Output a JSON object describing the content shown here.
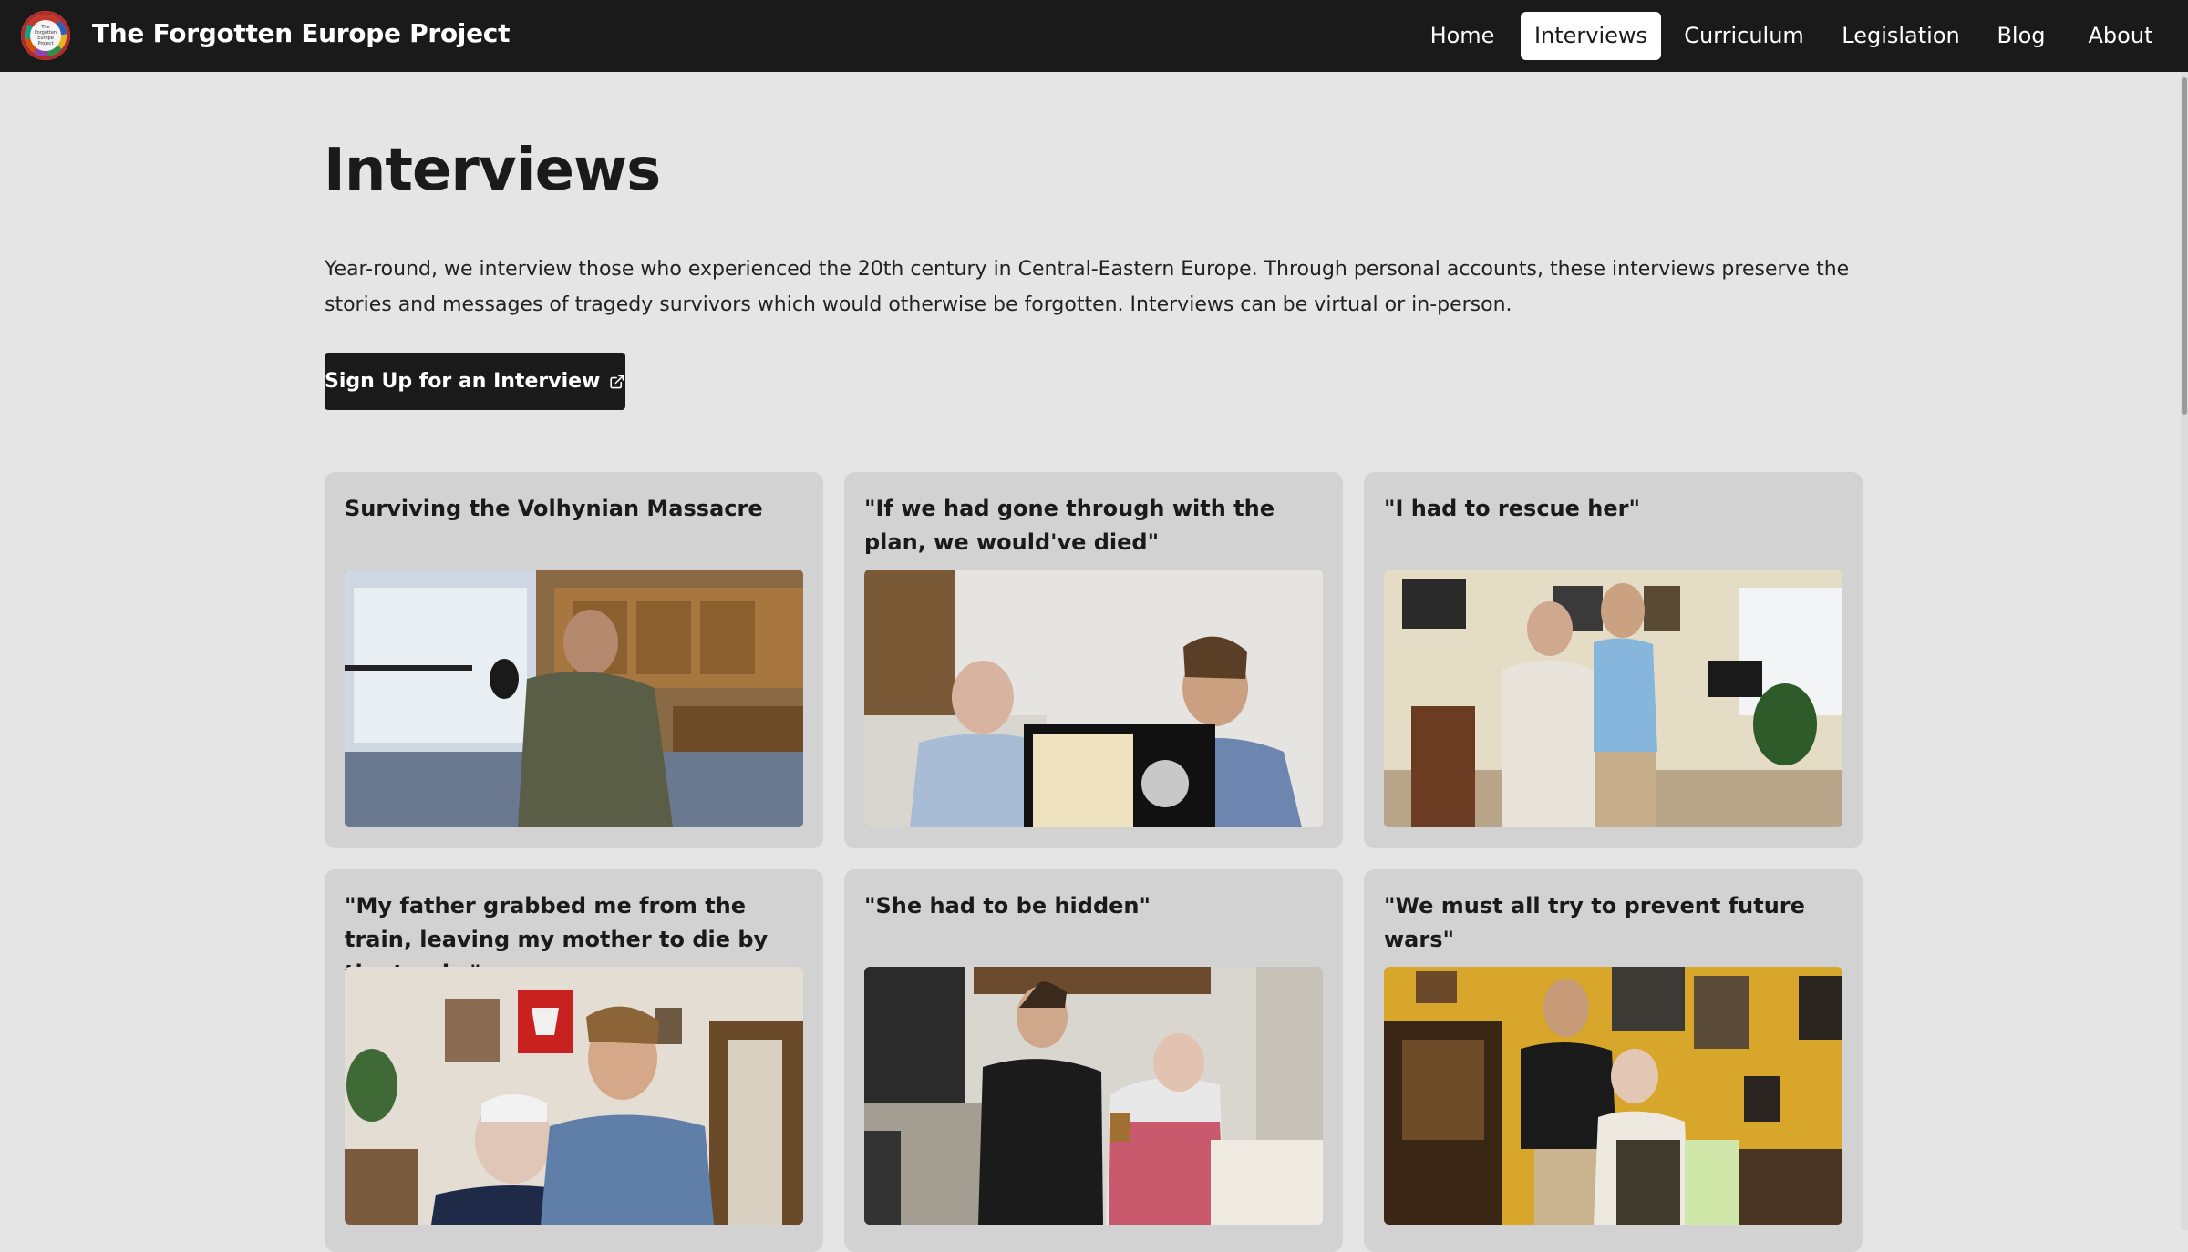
{
  "header": {
    "site_title": "The Forgotten Europe Project",
    "logo_text": "The Forgotten Europe Project",
    "nav": [
      {
        "label": "Home",
        "active": false
      },
      {
        "label": "Interviews",
        "active": true
      },
      {
        "label": "Curriculum",
        "active": false
      },
      {
        "label": "Legislation",
        "active": false
      },
      {
        "label": "Blog",
        "active": false
      },
      {
        "label": "About",
        "active": false
      }
    ]
  },
  "main": {
    "title": "Interviews",
    "intro": "Year-round, we interview those who experienced the 20th century in Central-Eastern Europe. Through personal accounts, these interviews preserve the stories and messages of tragedy survivors which would otherwise be forgotten. Interviews can be virtual or in-person.",
    "signup_label": "Sign Up for an Interview",
    "signup_icon": "external-link-icon",
    "cards": [
      {
        "title": "Surviving the Volhynian Massacre"
      },
      {
        "title": "\"If we had gone through with the plan, we would've died\""
      },
      {
        "title": "\"I had to rescue her\""
      },
      {
        "title": "\"My father grabbed me from the train, leaving my mother to die by the tracks\""
      },
      {
        "title": "\"She had to be hidden\""
      },
      {
        "title": "\"We must all try to prevent future wars\""
      }
    ]
  },
  "colors": {
    "navbar_bg": "#1a1a1a",
    "page_bg": "#e5e5e5",
    "card_bg": "#d2d2d2",
    "button_bg": "#1a1a1a",
    "active_nav_bg": "#ffffff"
  }
}
